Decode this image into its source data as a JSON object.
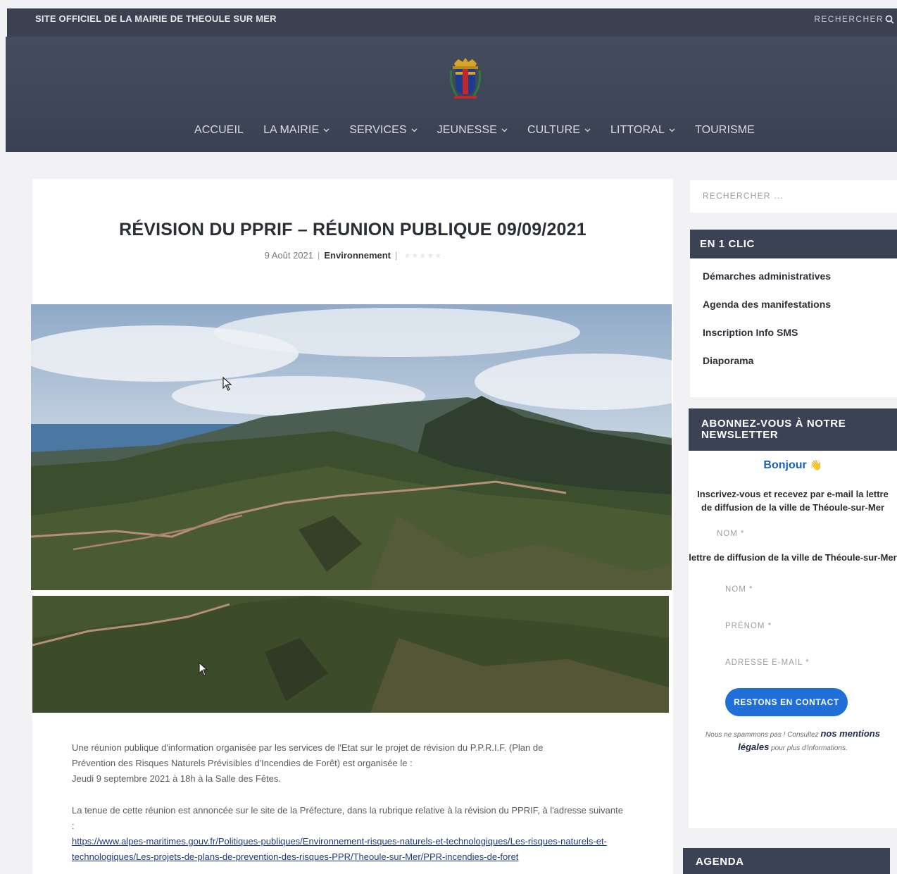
{
  "header": {
    "site_name": "SITE OFFICIEL DE LA MAIRIE DE THEOULE SUR MER",
    "search_label": "RECHERCHER"
  },
  "nav": {
    "items": [
      {
        "label": "ACCUEIL",
        "has_dropdown": false
      },
      {
        "label": "LA MAIRIE",
        "has_dropdown": true
      },
      {
        "label": "SERVICES",
        "has_dropdown": true
      },
      {
        "label": "JEUNESSE",
        "has_dropdown": true
      },
      {
        "label": "CULTURE",
        "has_dropdown": true
      },
      {
        "label": "LITTORAL",
        "has_dropdown": true
      },
      {
        "label": "TOURISME",
        "has_dropdown": false
      }
    ]
  },
  "article": {
    "title": "RÉVISION DU PPRIF – RÉUNION PUBLIQUE 09/09/2021",
    "date": "9 Août 2021",
    "category": "Environnement",
    "paragraph1_line1": "Une réunion publique d'information organisée par les services de l'Etat sur le projet de révision du P.P.R.I.F. (Plan de",
    "paragraph1_line2": "Prévention des Risques Naturels Prévisibles d'Incendies de Forêt) est organisée le :",
    "paragraph1_line3": "Jeudi 9 septembre 2021 à 18h à la Salle des Fêtes.",
    "paragraph2": "La tenue de cette réunion est annoncée sur le site de la Préfecture, dans la rubrique relative à la révision du PPRIF, à l'adresse suivante :",
    "link": "https://www.alpes-maritimes.gouv.fr/Politiques-publiques/Environnement-risques-naturels-et-technologiques/Les-risques-naturels-et-technologiques/Les-projets-de-plans-de-prevention-des-risques-PPR/Theoule-sur-Mer/PPR-incendies-de-foret"
  },
  "sidebar": {
    "search_placeholder": "RECHERCHER ...",
    "clic": {
      "title": "EN 1 CLIC",
      "links": [
        "Démarches administratives",
        "Agenda des manifestations",
        "Inscription Info SMS",
        "Diaporama"
      ]
    },
    "newsletter": {
      "title": "ABONNEZ-VOUS À NOTRE NEWSLETTER",
      "greeting": "Bonjour",
      "greeting_emoji": "👋",
      "intro": "Inscrivez-vous et recevez par e-mail la lettre de diffusion de la ville de Théoule-sur-Mer",
      "intro_repeat": "lettre de diffusion de la ville de Théoule-sur-Mer",
      "field_name_1": "NOM *",
      "field_name_2": "NOM *",
      "field_firstname": "PRÉNOM *",
      "field_email": "ADRESSE E-MAIL *",
      "submit": "RESTONS EN CONTACT",
      "legal_prefix": "Nous ne spammons pas ! Consultez",
      "legal_link": "nos mentions légales",
      "legal_suffix": "pour plus d'informations."
    },
    "agenda_title": "AGENDA"
  },
  "colors": {
    "header_bg": "#3b4150",
    "widget_header_bg": "#3a4254",
    "cta_bg": "#1f6fd6",
    "greeting": "#1e61b5"
  }
}
